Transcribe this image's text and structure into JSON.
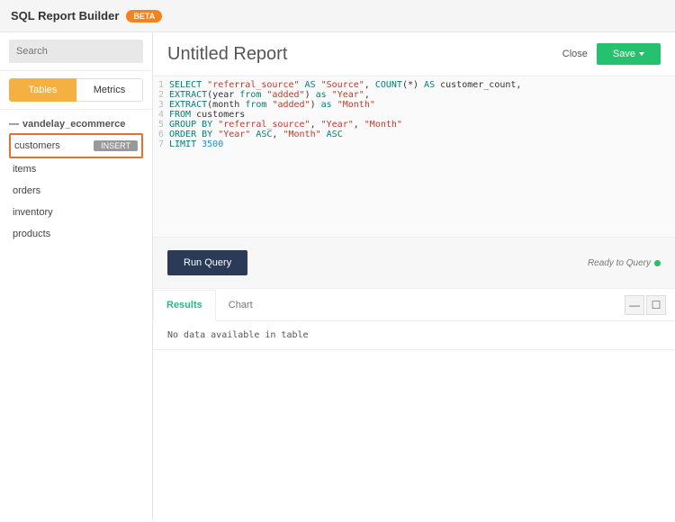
{
  "header": {
    "title": "SQL Report Builder",
    "badge": "BETA"
  },
  "sidebar": {
    "search_placeholder": "Search",
    "tabs": {
      "tables": "Tables",
      "metrics": "Metrics"
    },
    "db_name": "vandelay_ecommerce",
    "tables": [
      {
        "name": "customers",
        "selected": true,
        "insert_label": "INSERT"
      },
      {
        "name": "items"
      },
      {
        "name": "orders"
      },
      {
        "name": "inventory"
      },
      {
        "name": "products"
      }
    ]
  },
  "report": {
    "title": "Untitled Report",
    "close": "Close",
    "save": "Save"
  },
  "sql": [
    [
      {
        "t": "kw",
        "v": "SELECT"
      },
      {
        "t": "p",
        "v": " "
      },
      {
        "t": "str",
        "v": "\"referral_source\""
      },
      {
        "t": "p",
        "v": " "
      },
      {
        "t": "kw",
        "v": "AS"
      },
      {
        "t": "p",
        "v": " "
      },
      {
        "t": "str",
        "v": "\"Source\""
      },
      {
        "t": "p",
        "v": ", "
      },
      {
        "t": "kw",
        "v": "COUNT"
      },
      {
        "t": "p",
        "v": "(*) "
      },
      {
        "t": "kw",
        "v": "AS"
      },
      {
        "t": "p",
        "v": " customer_count,"
      }
    ],
    [
      {
        "t": "kw",
        "v": "EXTRACT"
      },
      {
        "t": "p",
        "v": "(year "
      },
      {
        "t": "kw",
        "v": "from"
      },
      {
        "t": "p",
        "v": " "
      },
      {
        "t": "str",
        "v": "\"added\""
      },
      {
        "t": "p",
        "v": ") "
      },
      {
        "t": "kw",
        "v": "as"
      },
      {
        "t": "p",
        "v": " "
      },
      {
        "t": "str",
        "v": "\"Year\""
      },
      {
        "t": "p",
        "v": ","
      }
    ],
    [
      {
        "t": "kw",
        "v": "EXTRACT"
      },
      {
        "t": "p",
        "v": "(month "
      },
      {
        "t": "kw",
        "v": "from"
      },
      {
        "t": "p",
        "v": " "
      },
      {
        "t": "str",
        "v": "\"added\""
      },
      {
        "t": "p",
        "v": ") "
      },
      {
        "t": "kw",
        "v": "as"
      },
      {
        "t": "p",
        "v": " "
      },
      {
        "t": "str",
        "v": "\"Month\""
      }
    ],
    [
      {
        "t": "kw",
        "v": "FROM"
      },
      {
        "t": "p",
        "v": " customers"
      }
    ],
    [
      {
        "t": "kw",
        "v": "GROUP BY"
      },
      {
        "t": "p",
        "v": " "
      },
      {
        "t": "str",
        "v": "\"referral_source\""
      },
      {
        "t": "p",
        "v": ", "
      },
      {
        "t": "str",
        "v": "\"Year\""
      },
      {
        "t": "p",
        "v": ", "
      },
      {
        "t": "str",
        "v": "\"Month\""
      }
    ],
    [
      {
        "t": "kw",
        "v": "ORDER BY"
      },
      {
        "t": "p",
        "v": " "
      },
      {
        "t": "str",
        "v": "\"Year\""
      },
      {
        "t": "p",
        "v": " "
      },
      {
        "t": "kw",
        "v": "ASC"
      },
      {
        "t": "p",
        "v": ", "
      },
      {
        "t": "str",
        "v": "\"Month\""
      },
      {
        "t": "p",
        "v": " "
      },
      {
        "t": "kw",
        "v": "ASC"
      }
    ],
    [
      {
        "t": "kw",
        "v": "LIMIT"
      },
      {
        "t": "p",
        "v": " "
      },
      {
        "t": "num",
        "v": "3500"
      }
    ]
  ],
  "runbar": {
    "run": "Run Query",
    "status": "Ready to Query"
  },
  "results": {
    "tabs": {
      "results": "Results",
      "chart": "Chart"
    },
    "empty": "No data available in table"
  }
}
